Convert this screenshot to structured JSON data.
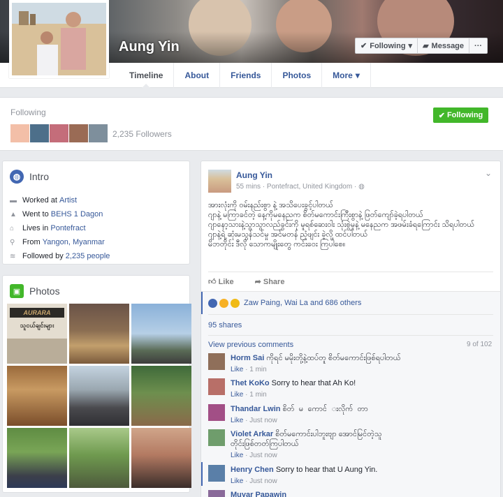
{
  "profile": {
    "name": "Aung Yin",
    "buttons": {
      "following": "Following",
      "message": "Message",
      "more": "···"
    },
    "tabs": [
      "Timeline",
      "About",
      "Friends",
      "Photos",
      "More"
    ]
  },
  "follow_card": {
    "title": "Following",
    "followers": "2,235 Followers",
    "button": "Following"
  },
  "intro": {
    "title": "Intro",
    "items": [
      {
        "prefix": "Worked at ",
        "link": "Artist"
      },
      {
        "prefix": "Went to ",
        "link": "BEHS 1 Dagon"
      },
      {
        "prefix": "Lives in ",
        "link": "Pontefract"
      },
      {
        "prefix": "From ",
        "link": "Yangon, Myanmar"
      },
      {
        "prefix": "Followed by ",
        "link": "2,235 people"
      }
    ]
  },
  "photos": {
    "title": "Photos",
    "sign_text_1": "AURARA",
    "sign_text_2": "သူငယ်ချင်းများ"
  },
  "post": {
    "author": "Aung Yin",
    "time": "55 mins",
    "location": "Pontefract, United Kingdom",
    "lines": [
      "အားလုံးကို ဝမ်းနည်းစွာ နဲ့ အသိပေးခွင့်ပါတယ်",
      "ဂျာနဲ့ မကြာခင်တဲ့ နေ့ကိုမနေညက စိတ်မကောင်းကြီးစွာနဲ့ ဖြတ်ကျော်ခဲ့ရပါတယ်",
      "ဂျာနော့သားနဲ့သွာသွာလည်ခွင်းကို မူရစ်ဆေးဝါး သုံးစွဲမှုနဲ့ မနေညက အဖမ်းခံရကြောင်း သိရပါတယ်",
      "ဂျာနဲ့ရဲ့ ဆုံးမသွန်သင်မှု အင်မတန် ညံ့ဖျင်း ခဲ့လို့ ထင်ပါတယ်",
      "မိဘတိုင်း ဒီလို သောကမျိုးတွေ ကင်းဝေး ကြပါစေ။"
    ],
    "like": "Like",
    "share": "Share",
    "reactions": "Zaw Paing, Wai La and 686 others",
    "shares": "95 shares",
    "view_previous": "View previous comments",
    "comment_count": "9 of 102",
    "comments": [
      {
        "name": "Horm Sai",
        "text": "ကိုရင် မမိုးတို့နဲ့ထပ်တူ စိတ်မကောင်းဖြစ်ရပါတယ်",
        "like": "Like",
        "time": "1 min"
      },
      {
        "name": "Thet KoKo",
        "text": "Sorry to hear that Ah Ko!",
        "like": "Like",
        "time": "1 min"
      },
      {
        "name": "Thandar Lwin",
        "text": "စိတ်�မ�ကောင်�းလိုက်�တာ",
        "like": "Like",
        "time": "Just now"
      },
      {
        "name": "Violet Arkar",
        "text": "စိတ်မကောင်းပါဘူးဗျာ အောင်မြင်တဲ့သူတိုင်းဖြစ်တတ်ကြပါတယ်",
        "like": "Like",
        "time": "Just now"
      },
      {
        "name": "Henry Chen",
        "text": "Sorry to hear that U Aung Yin.",
        "like": "Like",
        "time": "Just now"
      },
      {
        "name": "Muyar Papawin",
        "text": "",
        "like": "",
        "time": ""
      }
    ]
  },
  "colors": {
    "link": "#365899",
    "green": "#42b72a",
    "bg": "#e9ebee",
    "fb_blue": "#4267b2"
  }
}
